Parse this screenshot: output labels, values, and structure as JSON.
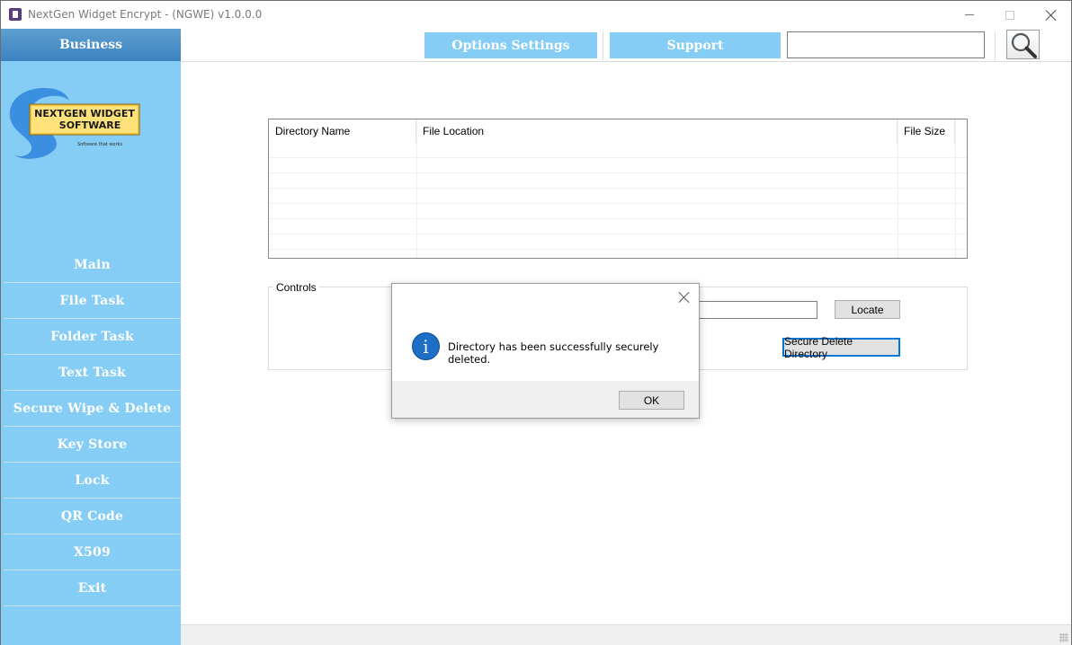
{
  "window": {
    "title": "NextGen Widget Encrypt - (NGWE) v1.0.0.0"
  },
  "sidebar": {
    "header": "Business",
    "logo_line1": "NEXTGEN WIDGET",
    "logo_line2": "SOFTWARE",
    "logo_tagline": "Software that works",
    "items": [
      {
        "label": "Main"
      },
      {
        "label": "File Task"
      },
      {
        "label": "Folder Task"
      },
      {
        "label": "Text Task"
      },
      {
        "label": "Secure Wipe & Delete"
      },
      {
        "label": "Key Store"
      },
      {
        "label": "Lock"
      },
      {
        "label": "QR Code"
      },
      {
        "label": "X509"
      },
      {
        "label": "Exit"
      }
    ]
  },
  "topbar": {
    "options_label": "Options Settings",
    "support_label": "Support",
    "search_value": "",
    "search_icon": "magnifier-icon"
  },
  "list": {
    "columns": [
      "Directory Name",
      "File Location",
      "File Size"
    ]
  },
  "controls": {
    "group_title": "Controls",
    "path_value": "",
    "locate_label": "Locate",
    "secure_delete_label": "Secure Delete Directory"
  },
  "dialog": {
    "message": "Directory has been successfully securely deleted.",
    "ok_label": "OK",
    "icon": "info-icon"
  },
  "colors": {
    "sidebar": "#86cdf5",
    "header": "#3c82c0",
    "dialog_icon": "#1c6fc4"
  }
}
